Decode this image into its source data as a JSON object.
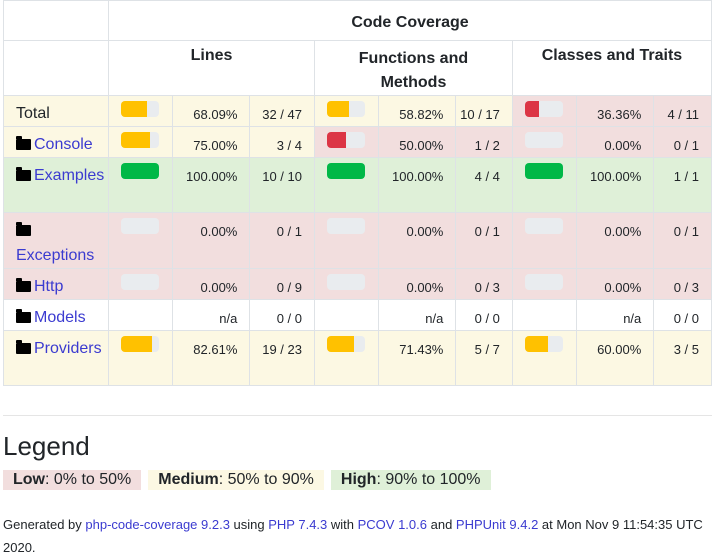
{
  "header": {
    "code_coverage": "Code Coverage",
    "lines": "Lines",
    "functions_line1": "Functions and",
    "functions_line2": "Methods",
    "classes": "Classes and Traits"
  },
  "rows": [
    {
      "name": "Total",
      "folder": false,
      "lines": {
        "pct": "68.09%",
        "num": "32 / 47",
        "level": "med",
        "fill": 68.09
      },
      "functions": {
        "pct": "58.82%",
        "num": "10 / 17",
        "level": "med",
        "fill": 58.82
      },
      "classes": {
        "pct": "36.36%",
        "num": "4 / 11",
        "level": "low",
        "fill": 36.36
      }
    },
    {
      "name": "Console",
      "folder": true,
      "lines": {
        "pct": "75.00%",
        "num": "3 / 4",
        "level": "med",
        "fill": 75
      },
      "functions": {
        "pct": "50.00%",
        "num": "1 / 2",
        "level": "low",
        "fill": 50
      },
      "classes": {
        "pct": "0.00%",
        "num": "0 / 1",
        "level": "low",
        "fill": 0
      }
    },
    {
      "name": "Examples",
      "folder": true,
      "lines": {
        "pct": "100.00%",
        "num": "10 / 10",
        "level": "high",
        "fill": 100
      },
      "functions": {
        "pct": "100.00%",
        "num": "4 / 4",
        "level": "high",
        "fill": 100
      },
      "classes": {
        "pct": "100.00%",
        "num": "1 / 1",
        "level": "high",
        "fill": 100
      }
    },
    {
      "name": "Exceptions",
      "folder": true,
      "lines": {
        "pct": "0.00%",
        "num": "0 / 1",
        "level": "low",
        "fill": 0
      },
      "functions": {
        "pct": "0.00%",
        "num": "0 / 1",
        "level": "low",
        "fill": 0
      },
      "classes": {
        "pct": "0.00%",
        "num": "0 / 1",
        "level": "low",
        "fill": 0
      }
    },
    {
      "name": "Http",
      "folder": true,
      "lines": {
        "pct": "0.00%",
        "num": "0 / 9",
        "level": "low",
        "fill": 0
      },
      "functions": {
        "pct": "0.00%",
        "num": "0 / 3",
        "level": "low",
        "fill": 0
      },
      "classes": {
        "pct": "0.00%",
        "num": "0 / 3",
        "level": "low",
        "fill": 0
      }
    },
    {
      "name": "Models",
      "folder": true,
      "lines": {
        "pct": "n/a",
        "num": "0 / 0",
        "level": "none",
        "fill": null
      },
      "functions": {
        "pct": "n/a",
        "num": "0 / 0",
        "level": "none",
        "fill": null
      },
      "classes": {
        "pct": "n/a",
        "num": "0 / 0",
        "level": "none",
        "fill": null
      }
    },
    {
      "name": "Providers",
      "folder": true,
      "lines": {
        "pct": "82.61%",
        "num": "19 / 23",
        "level": "med",
        "fill": 82.61
      },
      "functions": {
        "pct": "71.43%",
        "num": "5 / 7",
        "level": "med",
        "fill": 71.43
      },
      "classes": {
        "pct": "60.00%",
        "num": "3 / 5",
        "level": "med",
        "fill": 60
      }
    }
  ],
  "legend": {
    "title": "Legend",
    "low_label": "Low",
    "low_range": ": 0% to 50%",
    "medium_label": "Medium",
    "medium_range": ": 50% to 90%",
    "high_label": "High",
    "high_range": ": 90% to 100%"
  },
  "footer": {
    "generated_by": "Generated by ",
    "php_code_coverage": "php-code-coverage 9.2.3",
    "using": " using ",
    "php": "PHP 7.4.3",
    "with": " with ",
    "pcov": "PCOV 1.0.6",
    "and": " and ",
    "phpunit": "PHPUnit 9.4.2",
    "at": " at Mon Nov 9 11:54:35 UTC 2020."
  },
  "colors": {
    "low": "#f2dede",
    "medium": "#fcf8e3",
    "high": "#dff0d8",
    "bar_low": "#dc3545",
    "bar_medium": "#ffc100",
    "bar_high": "#00b847",
    "link": "#3b3bd0"
  }
}
